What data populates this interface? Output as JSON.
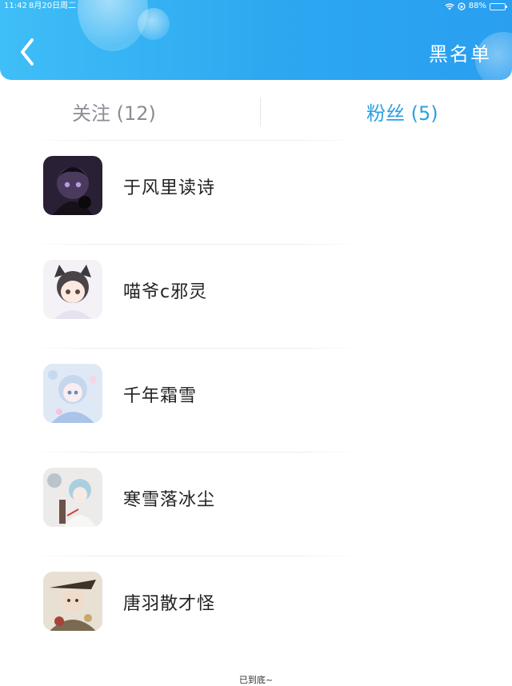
{
  "status_bar": {
    "time": "11:42",
    "date": "8月20日周二",
    "battery": "88%",
    "battery_level": 0.88,
    "icons": [
      "wifi-icon",
      "orientation-lock-icon",
      "battery-icon"
    ]
  },
  "header": {
    "back_icon": "chevron-left-icon",
    "blacklist_label": "黑名单",
    "gradient_start": "#3fbef7",
    "gradient_end": "#2a9ff0"
  },
  "tabs": [
    {
      "label": "关注 (12)",
      "active": false
    },
    {
      "label": "粉丝 (5)",
      "active": true
    }
  ],
  "colors": {
    "active_tab": "#2d9fe3",
    "inactive_tab": "#8a8d94",
    "name_text": "#222222"
  },
  "followers": [
    {
      "name": "于风里读诗"
    },
    {
      "name": "喵爷c邪灵"
    },
    {
      "name": "千年霜雪"
    },
    {
      "name": "寒雪落冰尘"
    },
    {
      "name": "唐羽散才怪"
    }
  ],
  "footer": {
    "text": "已到底~"
  }
}
